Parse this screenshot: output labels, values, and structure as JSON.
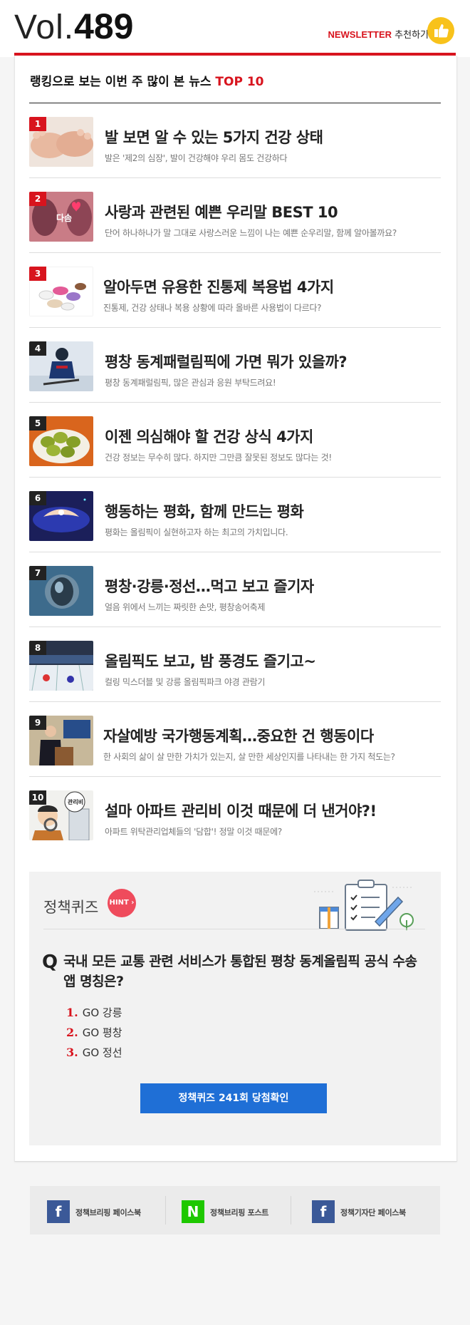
{
  "header": {
    "vol_prefix": "Vol.",
    "vol_number": "489",
    "newsletter_label": "NEWSLETTER",
    "recommend_label": "추천하기"
  },
  "ranking": {
    "title_prefix": "랭킹으로 보는 이번 주 많이 본 뉴스",
    "title_highlight": "TOP 10",
    "items": [
      {
        "rank": "1",
        "title": "발 보면 알 수 있는 5가지 건강 상태",
        "subtitle": "발은 '제2의 심장', 발이 건강해야 우리 몸도 건강하다"
      },
      {
        "rank": "2",
        "title": "사랑과 관련된 예쁜 우리말 BEST 10",
        "subtitle": "단어 하나하나가 말 그대로 사랑스러운 느낌이 나는 예쁜 순우리말, 함께 알아볼까요?",
        "image_text": "다솜"
      },
      {
        "rank": "3",
        "title": "알아두면 유용한 진통제 복용법 4가지",
        "subtitle": "진통제, 건강 상태나 복용 상황에 따라 올바른 사용법이 다르다?"
      },
      {
        "rank": "4",
        "title": "평창 동계패럴림픽에 가면 뭐가 있을까?",
        "subtitle": "평창 동계패럴림픽, 많은 관심과 응원 부탁드려요!"
      },
      {
        "rank": "5",
        "title": "이젠 의심해야 할 건강 상식 4가지",
        "subtitle": "건강 정보는 무수히 많다. 하지만 그만큼 잘못된 정보도 많다는 것!"
      },
      {
        "rank": "6",
        "title": "행동하는 평화, 함께 만드는 평화",
        "subtitle": "평화는 올림픽이 실현하고자 하는 최고의 가치입니다."
      },
      {
        "rank": "7",
        "title": "평창·강릉·정선…먹고 보고 즐기자",
        "subtitle": "얼음 위에서 느끼는 짜릿한 손맛, 평창송어축제"
      },
      {
        "rank": "8",
        "title": "올림픽도 보고, 밤 풍경도 즐기고~",
        "subtitle": "컬링 믹스더블 및 강릉 올림픽파크 야경 관람기"
      },
      {
        "rank": "9",
        "title": "자살예방 국가행동계획…중요한 건 행동이다",
        "subtitle": "한 사회의 삶이 살 만한 가치가 있는지, 살 만한 세상인지를 나타내는 한 가지 척도는?"
      },
      {
        "rank": "10",
        "title": "설마 아파트 관리비 이것 때문에 더 낸거야?!",
        "subtitle": "아파트 위탁관리업체들의 '담합'! 정말 이것 때문에?",
        "image_text": "관리비"
      }
    ]
  },
  "quiz": {
    "title": "정책퀴즈",
    "hint_label": "HINT",
    "q_mark": "Q",
    "question": "국내 모든 교통 관련 서비스가 통합된 평창 동계올림픽 공식 수송앱 명칭은?",
    "options": [
      {
        "num": "1.",
        "text": "GO 강릉"
      },
      {
        "num": "2.",
        "text": "GO 평창"
      },
      {
        "num": "3.",
        "text": "GO 정선"
      }
    ],
    "button_label": "정책퀴즈 241회 당첨확인"
  },
  "footer": {
    "links": [
      {
        "icon": "f",
        "label": "정책브리핑 페이스북"
      },
      {
        "icon": "N",
        "label": "정책브리핑 포스트"
      },
      {
        "icon": "f",
        "label": "정책기자단 페이스북"
      }
    ]
  },
  "colors": {
    "accent_red": "#d8141e",
    "button_blue": "#1f6fd6",
    "hint_red": "#ef4b5c",
    "facebook_blue": "#3b5998",
    "naver_green": "#1ec800",
    "thumb_yellow": "#f8c21b"
  }
}
